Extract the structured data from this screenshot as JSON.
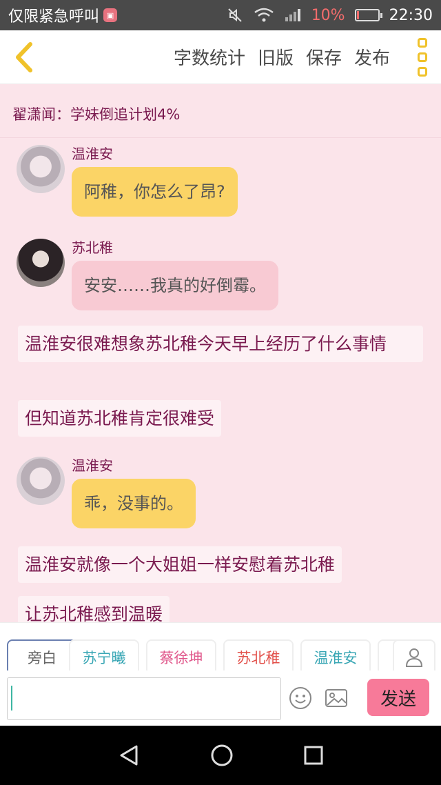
{
  "status_bar": {
    "carrier": "仅限紧急呼叫",
    "badge_glyph": "▣",
    "battery_percent": "10%",
    "battery_level": 0.1,
    "time": "22:30"
  },
  "top_bar": {
    "actions": [
      "字数统计",
      "旧版",
      "保存",
      "发布"
    ]
  },
  "story": {
    "title": "翟潇闻：学妹倒追计划4%"
  },
  "messages": [
    {
      "sender": "温淮安",
      "text": "阿稚，你怎么了昂?",
      "bubble": "yellow"
    },
    {
      "sender": "苏北稚",
      "text": "安安……我真的好倒霉。",
      "bubble": "pink"
    },
    {
      "narration": "温淮安很难想象苏北稚今天早上经历了什么事情"
    },
    {
      "narration": "但知道苏北稚肯定很难受"
    },
    {
      "sender": "温淮安",
      "text": "乖，没事的。",
      "bubble": "yellow"
    },
    {
      "narration": "温淮安就像一个大姐姐一样安慰着苏北稚"
    },
    {
      "narration": "让苏北稚感到温暖"
    }
  ],
  "role_tags": [
    {
      "label": "旁白",
      "color": "#666666"
    },
    {
      "label": "苏宁曦",
      "color": "#3aa7b5"
    },
    {
      "label": "蔡徐坤",
      "color": "#e0578b"
    },
    {
      "label": "苏北稚",
      "color": "#e2504a"
    },
    {
      "label": "温淮安",
      "color": "#3aa7b5"
    }
  ],
  "input": {
    "value": "",
    "send_label": "发送"
  },
  "colors": {
    "accent_yellow": "#fbd466",
    "accent_pink": "#f77a99",
    "text_plum": "#7a1a4f"
  }
}
